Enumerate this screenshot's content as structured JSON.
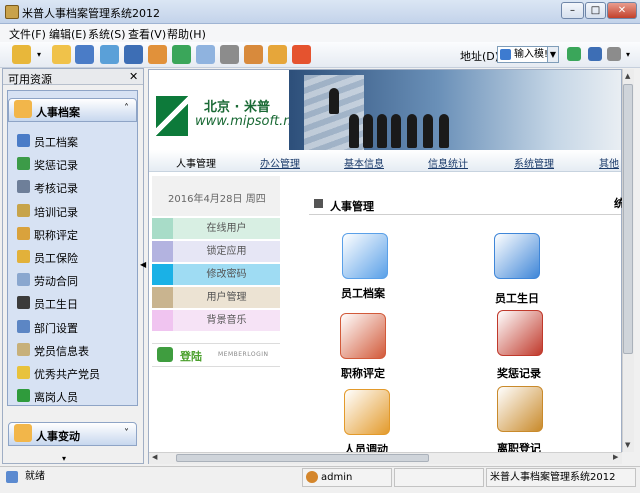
{
  "window": {
    "title": "米普人事档案管理系统2012",
    "min": "–",
    "max": "□",
    "close": "✕"
  },
  "menu": [
    "文件(F)",
    "编辑(E)",
    "系统(S)",
    "查看(V)",
    "帮助(H)"
  ],
  "toolbar": {
    "icons": [
      "open-folder-icon",
      "folder-icon",
      "grid-icon",
      "contacts-icon",
      "card-icon",
      "home-icon",
      "refresh-icon",
      "mail-icon",
      "print-icon",
      "person-icon",
      "key-icon",
      "power-icon"
    ],
    "address_label": "地址(D)",
    "address_value": "输入模!",
    "right_icons": [
      "go-icon",
      "save-icon",
      "print-settings-icon"
    ]
  },
  "left_pane": {
    "title": "可用资源",
    "close": "✕",
    "group1": {
      "label": "人事档案",
      "chevron": "˄"
    },
    "items": [
      {
        "label": "员工档案",
        "color": "#4a7cc7"
      },
      {
        "label": "奖惩记录",
        "color": "#3c9b48"
      },
      {
        "label": "考核记录",
        "color": "#6e7f99"
      },
      {
        "label": "培训记录",
        "color": "#c7a44a"
      },
      {
        "label": "职称评定",
        "color": "#d9a23c"
      },
      {
        "label": "员工保险",
        "color": "#e2b13a"
      },
      {
        "label": "劳动合同",
        "color": "#8aa7cf"
      },
      {
        "label": "员工生日",
        "color": "#3b3b3b"
      },
      {
        "label": "部门设置",
        "color": "#5c86c4"
      },
      {
        "label": "党员信息表",
        "color": "#c7b07a"
      },
      {
        "label": "优秀共产党员",
        "color": "#e8c23c"
      },
      {
        "label": "离岗人员",
        "color": "#2f9b3c"
      }
    ],
    "group2": {
      "label": "人事变动",
      "chevron": "˅"
    }
  },
  "banner": {
    "city": "北京 · 米普",
    "url": "www.mipsoft.net"
  },
  "top_nav": [
    "人事管理",
    "办公管理",
    "基本信息",
    "信息统计",
    "系统管理",
    "其他"
  ],
  "side": {
    "date": "2016年4月28日  周四",
    "rows": [
      {
        "label": "在线用户",
        "swatch": "#a8dcc8",
        "bg": "#d8efe3"
      },
      {
        "label": "锁定应用",
        "swatch": "#b3b3e0",
        "bg": "#e6e6f5"
      },
      {
        "label": "修改密码",
        "swatch": "#1ab1e6",
        "bg": "#9fdcf3"
      },
      {
        "label": "用户管理",
        "swatch": "#c9b48f",
        "bg": "#ece3d3"
      },
      {
        "label": "背景音乐",
        "swatch": "#f0c4f0",
        "bg": "#f6e3f6"
      }
    ],
    "login": "登陆",
    "login_sub": "MEMBERLOGIN"
  },
  "section": {
    "title": "人事管理",
    "extra": "统"
  },
  "tiles": [
    {
      "label": "员工档案",
      "icon": "document-folder-icon",
      "color": "#5aa0e8"
    },
    {
      "label": "员工生日",
      "icon": "mac-finder-icon",
      "color": "#3f86d8"
    },
    {
      "label": "职称评定",
      "icon": "books-icon",
      "color": "#d25a3a"
    },
    {
      "label": "奖惩记录",
      "icon": "gift-box-icon",
      "color": "#c0392b"
    },
    {
      "label": "人员调动",
      "icon": "exit-person-icon",
      "color": "#e39a2b"
    },
    {
      "label": "离职登记",
      "icon": "door-runner-icon",
      "color": "#c98a2b"
    }
  ],
  "status": {
    "ready": "就绪",
    "user": "admin",
    "app": "米普人事档案管理系统2012"
  }
}
